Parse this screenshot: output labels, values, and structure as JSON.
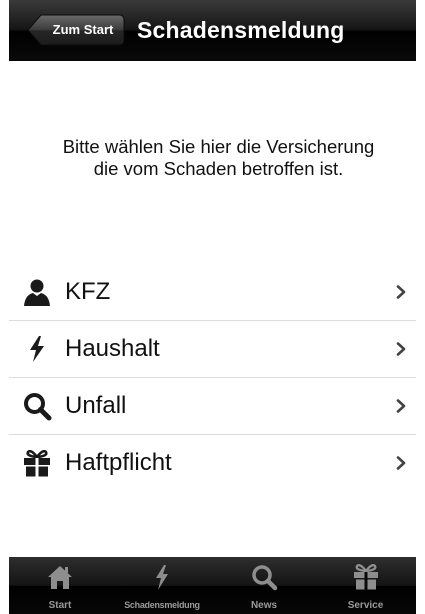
{
  "navbar": {
    "back_label": "Zum Start",
    "title": "Schadensmeldung"
  },
  "intro_text": "Bitte wählen Sie hier die Versicherung die vom Schaden betroffen ist.",
  "menu": {
    "items": [
      {
        "label": "KFZ",
        "icon": "person-icon"
      },
      {
        "label": "Haushalt",
        "icon": "lightning-icon"
      },
      {
        "label": "Unfall",
        "icon": "search-icon"
      },
      {
        "label": "Haftpflicht",
        "icon": "gift-icon"
      }
    ]
  },
  "tabbar": {
    "tabs": [
      {
        "label": "Start",
        "icon": "home-icon"
      },
      {
        "label": "Schadensmeldung",
        "icon": "lightning-icon"
      },
      {
        "label": "News",
        "icon": "search-icon"
      },
      {
        "label": "Service",
        "icon": "gift-icon"
      }
    ]
  },
  "colors": {
    "bar_dark": "#000000",
    "tab_label": "#9a9a9a",
    "divider": "#dcdcdc"
  }
}
